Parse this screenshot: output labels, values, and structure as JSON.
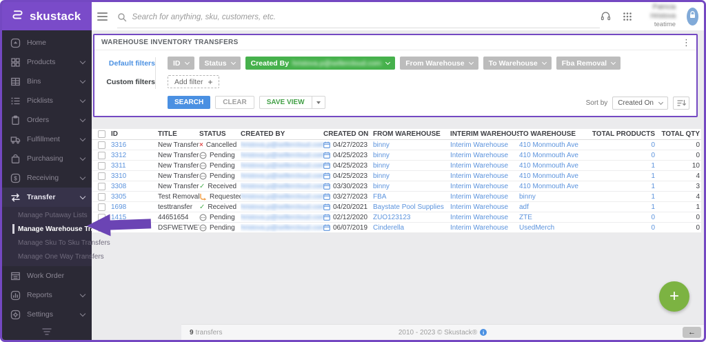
{
  "brand": {
    "name": "skustack",
    "accent_purple": "#7a4bc9",
    "annotation_purple": "#6b44b4"
  },
  "topbar": {
    "search_placeholder": "Search for anything, sku, customers, etc.",
    "user_name": "Patricia Hristova",
    "user_team": "teatime"
  },
  "sidebar": {
    "items": [
      {
        "label": "Home",
        "icon": "home-icon",
        "chevron": false
      },
      {
        "label": "Products",
        "icon": "products-icon",
        "chevron": true
      },
      {
        "label": "Bins",
        "icon": "bins-icon",
        "chevron": true
      },
      {
        "label": "Picklists",
        "icon": "picklists-icon",
        "chevron": true
      },
      {
        "label": "Orders",
        "icon": "orders-icon",
        "chevron": true
      },
      {
        "label": "Fulfillment",
        "icon": "fulfillment-icon",
        "chevron": true
      },
      {
        "label": "Purchasing",
        "icon": "purchasing-icon",
        "chevron": true
      },
      {
        "label": "Receiving",
        "icon": "receiving-icon",
        "chevron": true
      },
      {
        "label": "Transfer",
        "icon": "transfer-icon",
        "chevron": true,
        "expanded": true
      },
      {
        "label": "Work Order",
        "icon": "work-order-icon",
        "chevron": false
      },
      {
        "label": "Reports",
        "icon": "reports-icon",
        "chevron": true
      },
      {
        "label": "Settings",
        "icon": "settings-icon",
        "chevron": true
      }
    ],
    "transfer_children": [
      {
        "label": "Manage Putaway Lists",
        "active": false
      },
      {
        "label": "Manage Warehouse Transfers",
        "active": true
      },
      {
        "label": "Manage Sku To Sku Transfers",
        "active": false
      },
      {
        "label": "Manage One Way Transfers",
        "active": false
      }
    ]
  },
  "panel": {
    "title": "WAREHOUSE INVENTORY TRANSFERS",
    "default_filters_label": "Default filters",
    "custom_filters_label": "Custom filters",
    "filters": [
      {
        "label": "ID",
        "active": false
      },
      {
        "label": "Status",
        "active": false
      },
      {
        "label": "Created By",
        "value": "hristova.p@sellercloud.com",
        "active": true
      },
      {
        "label": "From Warehouse",
        "active": false
      },
      {
        "label": "To Warehouse",
        "active": false
      },
      {
        "label": "Fba Removal",
        "active": false
      }
    ],
    "add_filter_label": "Add filter",
    "search_label": "SEARCH",
    "clear_label": "CLEAR",
    "save_view_label": "SAVE VIEW",
    "sort_by_label": "Sort by",
    "sort_value": "Created On"
  },
  "table": {
    "columns": [
      "ID",
      "TITLE",
      "STATUS",
      "CREATED BY",
      "CREATED ON",
      "FROM WAREHOUSE",
      "INTERIM WAREHOUSE",
      "TO WAREHOUSE",
      "TOTAL PRODUCTS",
      "TOTAL QTY"
    ],
    "rows": [
      {
        "id": "3316",
        "title": "New Transfer",
        "status": "Cancelled",
        "status_kind": "cancelled",
        "created_by": "hristova.p@sellercloud.com",
        "created_on": "04/27/2023",
        "from_warehouse": "binny",
        "interim_warehouse": "Interim Warehouse",
        "to_warehouse": "410 Monmouth Ave",
        "total_products": "0",
        "total_qty": "0"
      },
      {
        "id": "3312",
        "title": "New Transfer",
        "status": "Pending",
        "status_kind": "pending",
        "created_by": "hristova.p@sellercloud.com",
        "created_on": "04/25/2023",
        "from_warehouse": "binny",
        "interim_warehouse": "Interim Warehouse",
        "to_warehouse": "410 Monmouth Ave",
        "total_products": "0",
        "total_qty": "0"
      },
      {
        "id": "3311",
        "title": "New Transfer",
        "status": "Pending",
        "status_kind": "pending",
        "created_by": "hristova.p@sellercloud.com",
        "created_on": "04/25/2023",
        "from_warehouse": "binny",
        "interim_warehouse": "Interim Warehouse",
        "to_warehouse": "410 Monmouth Ave",
        "total_products": "1",
        "total_qty": "10"
      },
      {
        "id": "3310",
        "title": "New Transfer",
        "status": "Pending",
        "status_kind": "pending",
        "created_by": "hristova.p@sellercloud.com",
        "created_on": "04/25/2023",
        "from_warehouse": "binny",
        "interim_warehouse": "Interim Warehouse",
        "to_warehouse": "410 Monmouth Ave",
        "total_products": "1",
        "total_qty": "4"
      },
      {
        "id": "3308",
        "title": "New Transfer",
        "status": "Received",
        "status_kind": "received",
        "created_by": "hristova.p@sellercloud.com",
        "created_on": "03/30/2023",
        "from_warehouse": "binny",
        "interim_warehouse": "Interim Warehouse",
        "to_warehouse": "410 Monmouth Ave",
        "total_products": "1",
        "total_qty": "3"
      },
      {
        "id": "3305",
        "title": "Test Removal",
        "status": "Requested",
        "status_kind": "requested",
        "created_by": "hristova.p@sellercloud.com",
        "created_on": "03/27/2023",
        "from_warehouse": "FBA",
        "interim_warehouse": "Interim Warehouse",
        "to_warehouse": "binny",
        "total_products": "1",
        "total_qty": "4"
      },
      {
        "id": "1698",
        "title": "testtransfer",
        "status": "Received",
        "status_kind": "received",
        "created_by": "hristova.p@sellercloud.com",
        "created_on": "04/20/2021",
        "from_warehouse": "Baystate Pool Supplies",
        "interim_warehouse": "Interim Warehouse",
        "to_warehouse": "adf",
        "total_products": "1",
        "total_qty": "1"
      },
      {
        "id": "1415",
        "title": "44651654",
        "status": "Pending",
        "status_kind": "pending",
        "created_by": "hristova.p@sellercloud.com",
        "created_on": "02/12/2020",
        "from_warehouse": "ZUO123123",
        "interim_warehouse": "Interim Warehouse",
        "to_warehouse": "ZTE",
        "total_products": "0",
        "total_qty": "0"
      },
      {
        "id": "",
        "title": "DSFWETWET",
        "status": "Pending",
        "status_kind": "pending",
        "created_by": "hristova.p@sellercloud.com",
        "created_on": "06/07/2019",
        "from_warehouse": "Cinderella",
        "interim_warehouse": "Interim Warehouse",
        "to_warehouse": "UsedMerch",
        "total_products": "0",
        "total_qty": "0"
      }
    ]
  },
  "footer": {
    "count": "9",
    "count_suffix": "transfers",
    "copyright": "2010 - 2023 © Skustack®"
  },
  "fab_label": "+"
}
